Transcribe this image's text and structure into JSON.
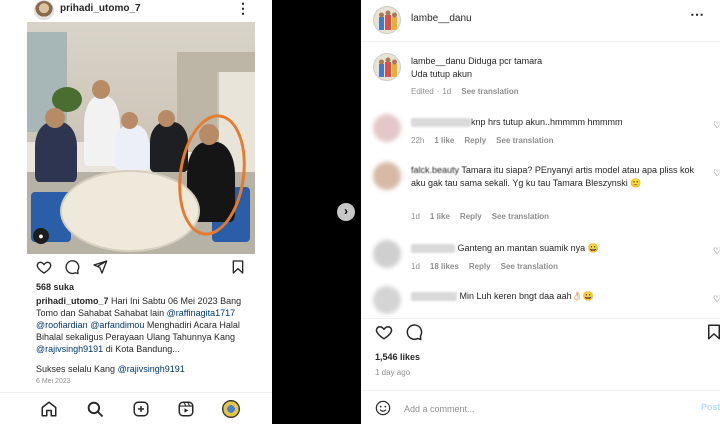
{
  "left_post": {
    "username": "prihadi_utomo_7",
    "likes": "568 suka",
    "caption": {
      "author": "prihadi_utomo_7",
      "text1": " Hari Ini Sabtu 06 Mei 2023 Bang Tomo dan Sahabat Sahabat lain ",
      "mention1": "@raffinagita1717",
      "mention2": "@roofiardian",
      "mention3": "@arfandimou",
      "text2": " Menghadiri Acara Halal Bihalal sekaligus Perayaan Ulang Tahunnya Kang ",
      "mention4": "@rajivsingh9191",
      "text3": " di Kota Bandung...",
      "line2_prefix": "Sukses selalu Kang ",
      "line2_mention": "@rajivsingh9191"
    },
    "date": "6 Mei 2023",
    "icons": [
      "heart-icon",
      "comment-icon",
      "share-icon",
      "bookmark-icon"
    ],
    "bottom_nav": [
      "home-icon",
      "search-icon",
      "create-icon",
      "reels-icon",
      "profile-icon"
    ]
  },
  "right_post": {
    "username": "lambe__danu",
    "post": {
      "author": "lambe__danu",
      "line1": "Diduga pcr tamara",
      "line2": "Uda tutup akun",
      "meta_edited": "Edited",
      "meta_time": "1d",
      "meta_translate": "See translation"
    },
    "comments": [
      {
        "text": "knp hrs tutup akun..hmmmm hmmmm",
        "time": "22h",
        "likes": "1 like",
        "reply": "Reply",
        "translate": "See translation"
      },
      {
        "author": "falck.beauty",
        "text": " Tamara itu siapa? PEnyanyi artis model atau apa pliss kok aku gak tau sama sekali. Yg ku tau Tamara Bleszynski 🙂",
        "time": "1d",
        "likes": "1 like",
        "reply": "Reply",
        "translate": "See translation"
      },
      {
        "text": "Ganteng an mantan suamik nya 😀",
        "time": "1d",
        "likes": "18 likes",
        "reply": "Reply",
        "translate": "See translation"
      },
      {
        "text": "Min Luh keren bngt daa aah👌🏻😀"
      }
    ],
    "likes": "1,546 likes",
    "ago": "1 day ago",
    "add_placeholder": "Add a comment...",
    "post_label": "Post"
  },
  "colors": {
    "link": "#00376b",
    "meta": "#8e8e8e",
    "annotation_circle": "#e77b2d"
  }
}
